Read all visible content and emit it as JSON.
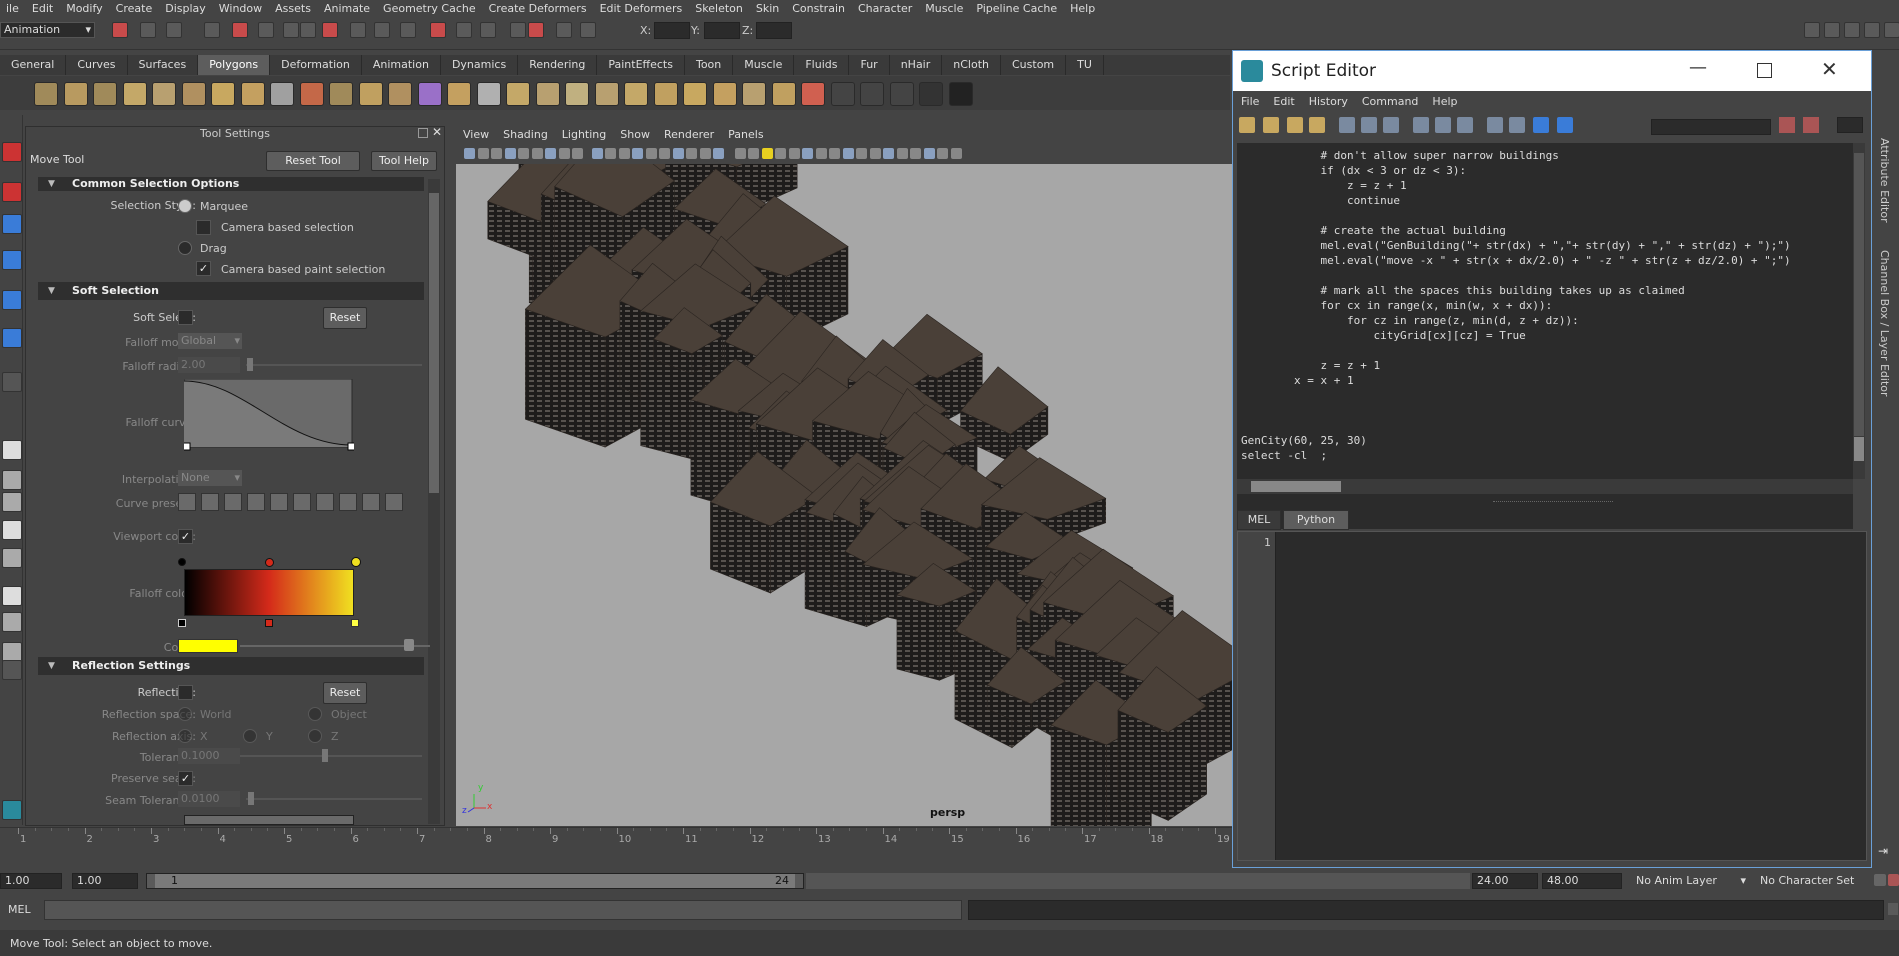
{
  "menubar": [
    "ile",
    "Edit",
    "Modify",
    "Create",
    "Display",
    "Window",
    "Assets",
    "Animate",
    "Geometry Cache",
    "Create Deformers",
    "Edit Deformers",
    "Skeleton",
    "Skin",
    "Constrain",
    "Character",
    "Muscle",
    "Pipeline Cache",
    "Help"
  ],
  "status_line": {
    "mode": "Animation",
    "x_label": "X:",
    "y_label": "Y:",
    "z_label": "Z:"
  },
  "shelf_tabs": [
    "General",
    "Curves",
    "Surfaces",
    "Polygons",
    "Deformation",
    "Animation",
    "Dynamics",
    "Rendering",
    "PaintEffects",
    "Toon",
    "Muscle",
    "Fluids",
    "Fur",
    "nHair",
    "nCloth",
    "Custom",
    "TU"
  ],
  "shelf_active_tab": "Polygons",
  "tool_settings": {
    "title": "Tool Settings",
    "tool_name": "Move Tool",
    "reset_tool": "Reset Tool",
    "tool_help": "Tool Help",
    "common_section": "Common Selection Options",
    "selection_style_label": "Selection Style:",
    "marquee": "Marquee",
    "camera_based_selection": "Camera based selection",
    "drag": "Drag",
    "camera_based_paint": "Camera based paint selection",
    "soft_section": "Soft Selection",
    "soft_select_label": "Soft Select:",
    "reset": "Reset",
    "falloff_mode_label": "Falloff mode:",
    "falloff_mode_value": "Global",
    "falloff_radius_label": "Falloff radius:",
    "falloff_radius_value": "2.00",
    "falloff_curve_label": "Falloff curve:",
    "interpolation_label": "Interpolation:",
    "interpolation_value": "None",
    "curve_presets_label": "Curve presets:",
    "viewport_color_label": "Viewport color:",
    "falloff_color_label": "Falloff color:",
    "color_label": "Color:",
    "reflection_section": "Reflection Settings",
    "reflection_label": "Reflection:",
    "reflection_space_label": "Reflection space:",
    "world": "World",
    "object": "Object",
    "reflection_axis_label": "Reflection axis:",
    "axis_x": "X",
    "axis_y": "Y",
    "axis_z": "Z",
    "tolerance_label": "Tolerance:",
    "tolerance_value": "0.1000",
    "preserve_seam_label": "Preserve seam:",
    "seam_tolerance_label": "Seam Tolerance:",
    "seam_tolerance_value": "0.0100"
  },
  "viewport": {
    "menus": [
      "View",
      "Shading",
      "Lighting",
      "Show",
      "Renderer",
      "Panels"
    ],
    "camera_label": "persp",
    "axis_y": "y",
    "axis_x": "x",
    "axis_z": "z"
  },
  "timeline": {
    "ticks": [
      "1",
      "2",
      "3",
      "4",
      "5",
      "6",
      "7",
      "8",
      "9",
      "10",
      "11",
      "12",
      "13",
      "14",
      "15",
      "16",
      "17",
      "18",
      "19"
    ]
  },
  "range": {
    "start": "1.00",
    "playback_start": "1.00",
    "range_start": "1",
    "range_end": "24",
    "playback_end": "24.00",
    "end": "48.00",
    "anim_layer": "No Anim Layer",
    "character_set": "No Character Set"
  },
  "command_line": {
    "lang": "MEL"
  },
  "help_line": "Move Tool: Select an object to move.",
  "script_editor": {
    "title": "Script Editor",
    "menus": [
      "File",
      "Edit",
      "History",
      "Command",
      "Help"
    ],
    "history_lines": [
      "            # don't allow super narrow buildings",
      "            if (dx < 3 or dz < 3):",
      "                z = z + 1",
      "                continue",
      "",
      "            # create the actual building",
      "            mel.eval(\"GenBuilding(\"+ str(dx) + \",\"+ str(dy) + \",\" + str(dz) + \");\")",
      "            mel.eval(\"move -x \" + str(x + dx/2.0) + \" -z \" + str(z + dz/2.0) + \";\")",
      "",
      "            # mark all the spaces this building takes up as claimed",
      "            for cx in range(x, min(w, x + dx)):",
      "                for cz in range(z, min(d, z + dz)):",
      "                    cityGrid[cx][cz] = True",
      "",
      "            z = z + 1",
      "        x = x + 1",
      "",
      "",
      "",
      "GenCity(60, 25, 30)",
      "select -cl  ;"
    ],
    "tab_mel": "MEL",
    "tab_python": "Python",
    "line_number": "1"
  },
  "right_strip": {
    "attribute_editor": "Attribute Editor",
    "channel_box": "Channel Box / Layer Editor"
  },
  "colors": {
    "accent": "#5d5d5d",
    "viewport_bg": "#a7a7a7",
    "building": "#4a4038",
    "falloff_start": "#000000",
    "falloff_mid": "#d42a1a",
    "falloff_end": "#f0e020",
    "color_swatch": "#ffff00"
  }
}
